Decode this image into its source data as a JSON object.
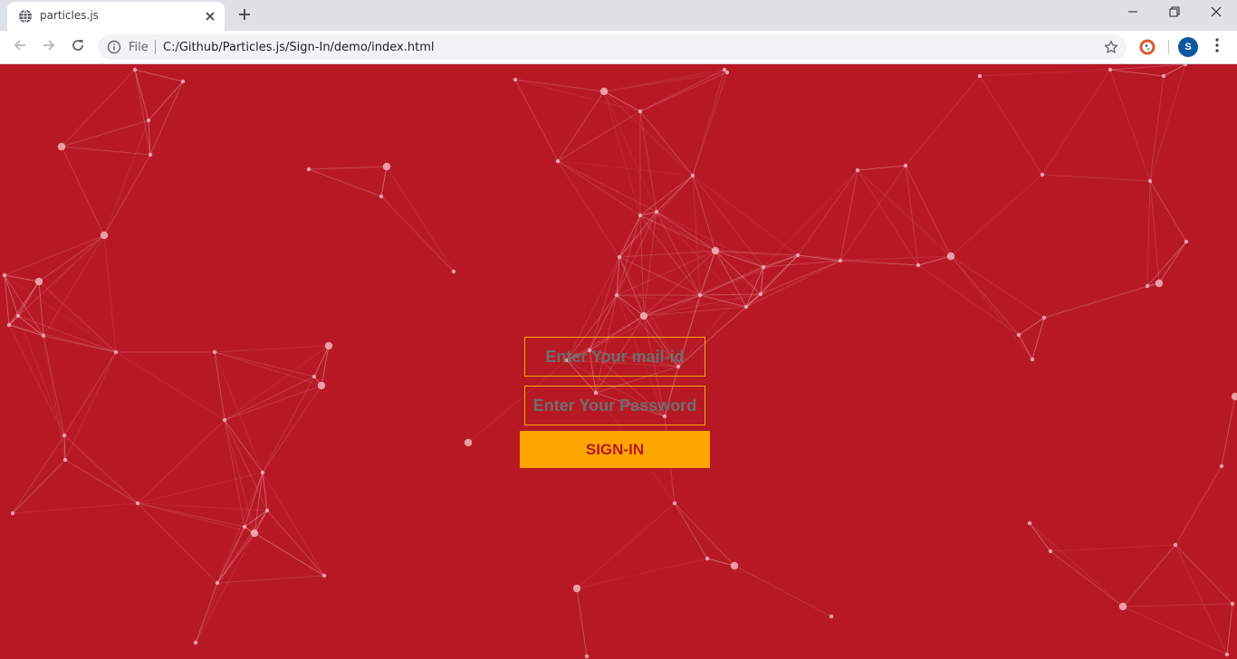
{
  "browser": {
    "tab": {
      "title": "particles.js"
    },
    "address_bar": {
      "security_label": "File",
      "url": "C:/Github/Particles.js/Sign-In/demo/index.html"
    },
    "profile": {
      "initial": "S",
      "color": "#0b57a0"
    }
  },
  "page": {
    "background_color": "#b71924",
    "accent_color": "#ffa500",
    "form": {
      "email_placeholder": "Enter Your mail-id",
      "password_placeholder": "Enter Your Password",
      "submit_label": "SIGN-IN"
    }
  },
  "icons": [
    "globe-icon",
    "close-icon",
    "plus-icon",
    "minimize-icon",
    "restore-icon",
    "back-icon",
    "forward-icon",
    "reload-icon",
    "info-icon",
    "star-icon",
    "duckduckgo-icon",
    "kebab-menu-icon"
  ]
}
